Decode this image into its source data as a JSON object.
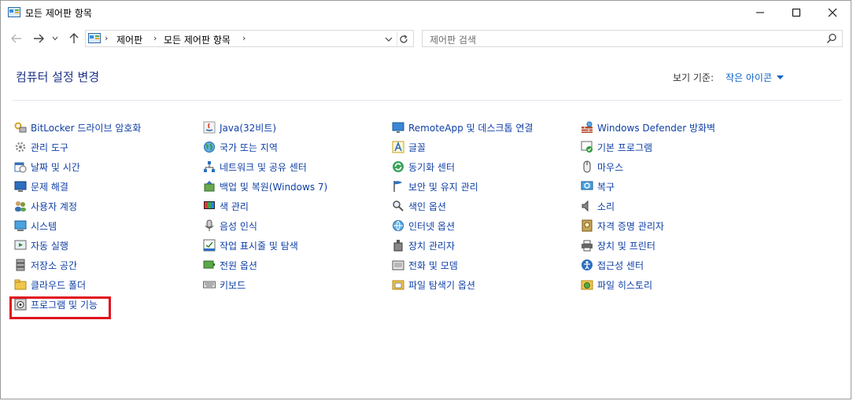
{
  "window": {
    "title": "모든 제어판 항목",
    "controls": {
      "minimize": "—",
      "maximize": "☐",
      "close": "✕"
    }
  },
  "nav": {
    "breadcrumb": [
      "제어판",
      "모든 제어판 항목"
    ],
    "search_placeholder": "제어판 검색"
  },
  "header": {
    "title": "컴퓨터 설정 변경",
    "view_label": "보기 기준:",
    "view_value": "작은 아이콘"
  },
  "columns": [
    {
      "items": [
        {
          "label": "BitLocker 드라이브 암호화",
          "icon": "bitlocker-icon"
        },
        {
          "label": "관리 도구",
          "icon": "admin-tools-icon"
        },
        {
          "label": "날짜 및 시간",
          "icon": "date-time-icon"
        },
        {
          "label": "문제 해결",
          "icon": "troubleshoot-icon"
        },
        {
          "label": "사용자 계정",
          "icon": "user-accounts-icon"
        },
        {
          "label": "시스템",
          "icon": "system-icon"
        },
        {
          "label": "자동 실행",
          "icon": "autoplay-icon"
        },
        {
          "label": "저장소 공간",
          "icon": "storage-spaces-icon"
        },
        {
          "label": "클라우드 폴더",
          "icon": "cloud-folder-icon"
        },
        {
          "label": "프로그램 및 기능",
          "icon": "programs-features-icon"
        }
      ]
    },
    {
      "items": [
        {
          "label": "Java(32비트)",
          "icon": "java-icon"
        },
        {
          "label": "국가 또는 지역",
          "icon": "region-icon"
        },
        {
          "label": "네트워크 및 공유 센터",
          "icon": "network-icon"
        },
        {
          "label": "백업 및 복원(Windows 7)",
          "icon": "backup-icon"
        },
        {
          "label": "색 관리",
          "icon": "color-management-icon"
        },
        {
          "label": "음성 인식",
          "icon": "speech-icon"
        },
        {
          "label": "작업 표시줄 및 탐색",
          "icon": "taskbar-icon"
        },
        {
          "label": "전원 옵션",
          "icon": "power-icon"
        },
        {
          "label": "키보드",
          "icon": "keyboard-icon"
        }
      ]
    },
    {
      "items": [
        {
          "label": "RemoteApp 및 데스크톱 연결",
          "icon": "remoteapp-icon"
        },
        {
          "label": "글꼴",
          "icon": "fonts-icon"
        },
        {
          "label": "동기화 센터",
          "icon": "sync-icon"
        },
        {
          "label": "보안 및 유지 관리",
          "icon": "security-flag-icon"
        },
        {
          "label": "색인 옵션",
          "icon": "indexing-icon"
        },
        {
          "label": "인터넷 옵션",
          "icon": "internet-options-icon"
        },
        {
          "label": "장치 관리자",
          "icon": "device-manager-icon"
        },
        {
          "label": "전화 및 모뎀",
          "icon": "phone-modem-icon"
        },
        {
          "label": "파일 탐색기 옵션",
          "icon": "explorer-options-icon"
        }
      ]
    },
    {
      "items": [
        {
          "label": "Windows Defender 방화벽",
          "icon": "firewall-icon"
        },
        {
          "label": "기본 프로그램",
          "icon": "default-programs-icon"
        },
        {
          "label": "마우스",
          "icon": "mouse-icon"
        },
        {
          "label": "복구",
          "icon": "recovery-icon"
        },
        {
          "label": "소리",
          "icon": "sound-icon"
        },
        {
          "label": "자격 증명 관리자",
          "icon": "credential-icon"
        },
        {
          "label": "장치 및 프린터",
          "icon": "devices-printers-icon"
        },
        {
          "label": "접근성 센터",
          "icon": "accessibility-icon"
        },
        {
          "label": "파일 히스토리",
          "icon": "file-history-icon"
        }
      ]
    }
  ],
  "colors": {
    "link": "#0f3fa6",
    "heading": "#1e3287",
    "highlight": "#e0141e"
  }
}
